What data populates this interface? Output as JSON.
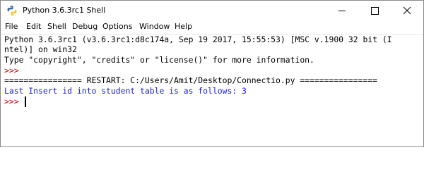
{
  "window": {
    "title": "Python 3.6.3rc1 Shell",
    "icon": "python-idle-icon",
    "controls": [
      "minimize-icon",
      "maximize-icon",
      "close-icon"
    ]
  },
  "menu": {
    "file": "File",
    "edit": "Edit",
    "shell": "Shell",
    "debug": "Debug",
    "options": "Options",
    "window": "Window",
    "help": "Help"
  },
  "shell": {
    "banner_line1": "Python 3.6.3rc1 (v3.6.3rc1:d8c174a, Sep 19 2017, 15:55:53) [MSC v.1900 32 bit (I",
    "banner_line2": "ntel)] on win32",
    "banner_line3": "Type \"copyright\", \"credits\" or \"license()\" for more information.",
    "prompt1": ">>> ",
    "restart_line": "================ RESTART: C:/Users/Amit/Desktop/Connectio.py ================",
    "output_line": "Last Insert id into student table is as follows: 3",
    "prompt2": ">>> "
  },
  "colors": {
    "prompt": "#c00000",
    "output": "#1a1aff",
    "text": "#000000",
    "background": "#ffffff"
  }
}
